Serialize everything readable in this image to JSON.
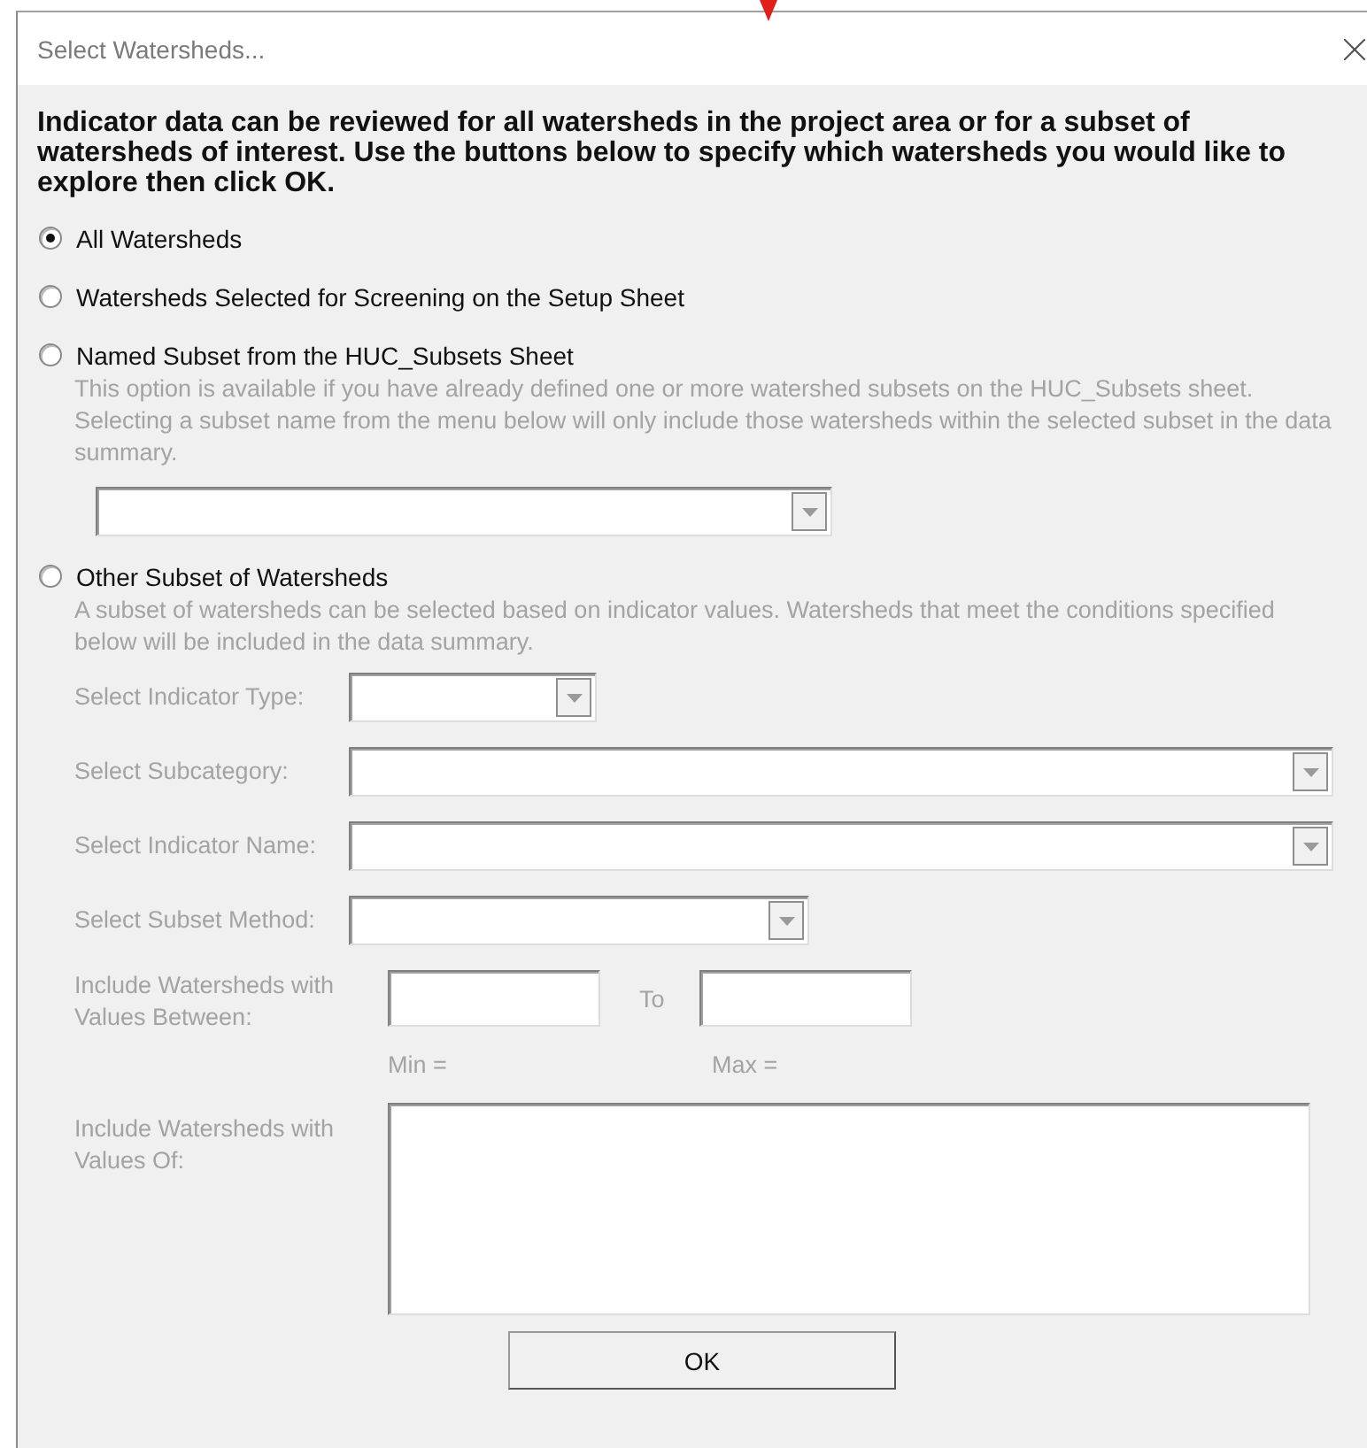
{
  "window": {
    "title": "Select Watersheds..."
  },
  "instructions": "Indicator data can be reviewed for all watersheds in the project area or for a subset of watersheds of interest. Use the buttons below to specify which watersheds you would like to explore then click OK.",
  "options": [
    {
      "label": "All Watersheds",
      "selected": true,
      "kind": "plain"
    },
    {
      "label": "Watersheds Selected for Screening on the Setup Sheet",
      "selected": false,
      "kind": "plain"
    },
    {
      "label": "Named Subset from the HUC_Subsets Sheet",
      "selected": false,
      "kind": "dropdown",
      "disabled": true,
      "description": "This option is available if you have already defined one or more watershed subsets on the HUC_Subsets sheet. Selecting a subset name from the menu below will only include those watersheds within the selected subset in the data summary."
    },
    {
      "label": "Other Subset of Watersheds",
      "selected": false,
      "kind": "filters",
      "disabled": true,
      "description": "A subset of watersheds can be selected based on indicator values. Watersheds that meet the conditions specified below will be included in the data summary."
    }
  ],
  "filters": [
    {
      "label": "Select Indicator Type:",
      "kind": "dropdown"
    },
    {
      "label": "Select Subcategory:",
      "kind": "dropdown"
    },
    {
      "label": "Select Indicator Name:",
      "kind": "dropdown"
    },
    {
      "label": "Select Subset Method:",
      "kind": "dropdown"
    },
    {
      "label": "Include Watersheds with Values Between:",
      "kind": "range",
      "separator": "To",
      "min_label": "Min =",
      "max_label": "Max ="
    },
    {
      "label": "Include Watersheds with Values Of:",
      "kind": "list"
    }
  ],
  "buttons": [
    {
      "label": "OK"
    }
  ]
}
